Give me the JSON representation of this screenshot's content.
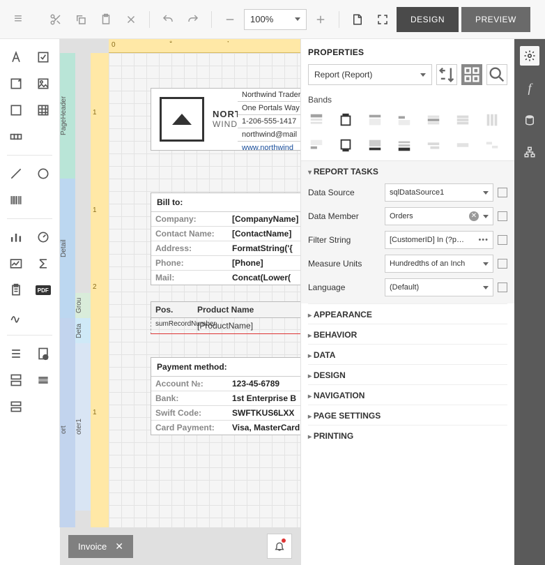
{
  "toolbar": {
    "zoom": "100%",
    "design_label": "DESIGN",
    "preview_label": "PREVIEW"
  },
  "bottom": {
    "tab_label": "Invoice"
  },
  "canvas": {
    "logo_top": "NORTH",
    "logo_bottom": "WIND",
    "company": {
      "name": "Northwind Traders",
      "addr": "One Portals Way",
      "phone": "1-206-555-1417",
      "email": "northwind@mail",
      "url": "www.northwind"
    },
    "billto": {
      "heading": "Bill to:",
      "rows": [
        {
          "label": "Company:",
          "value": "[CompanyName]"
        },
        {
          "label": "Contact Name:",
          "value": "[ContactName]"
        },
        {
          "label": "Address:",
          "value": "FormatString('{"
        },
        {
          "label": "Phone:",
          "value": "[Phone]"
        },
        {
          "label": "Mail:",
          "value": "Concat(Lower("
        }
      ]
    },
    "table": {
      "col_pos": "Pos.",
      "col_name": "Product Name",
      "row_pos": "sumRecordNumber",
      "row_name": "[ProductName]"
    },
    "payment": {
      "heading": "Payment method:",
      "rows": [
        {
          "label": "Account №:",
          "value": "123-45-6789"
        },
        {
          "label": "Bank:",
          "value": "1st Enterprise B"
        },
        {
          "label": "Swift Code:",
          "value": "SWFTKUS6LXX"
        },
        {
          "label": "Card Payment:",
          "value": "Visa, MasterCard"
        }
      ]
    },
    "bands": {
      "page_header": "PageHeader",
      "detail": "Detail",
      "group": "Grou",
      "deta": "Deta",
      "footer": "oter1",
      "rpt": "ort"
    }
  },
  "props": {
    "title": "PROPERTIES",
    "object": "Report (Report)",
    "bands_label": "Bands",
    "sections": {
      "report_tasks": "REPORT TASKS",
      "appearance": "APPEARANCE",
      "behavior": "BEHAVIOR",
      "data": "DATA",
      "design": "DESIGN",
      "navigation": "NAVIGATION",
      "page_settings": "PAGE SETTINGS",
      "printing": "PRINTING"
    },
    "report_tasks": {
      "data_source_label": "Data Source",
      "data_source_value": "sqlDataSource1",
      "data_member_label": "Data Member",
      "data_member_value": "Orders",
      "filter_label": "Filter String",
      "filter_value": "[CustomerID] In (?p…",
      "measure_label": "Measure Units",
      "measure_value": "Hundredths of an Inch",
      "language_label": "Language",
      "language_value": "(Default)"
    }
  }
}
